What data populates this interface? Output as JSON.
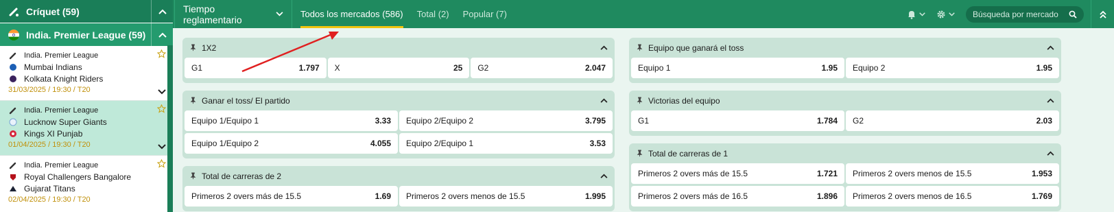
{
  "sidebar": {
    "sport": {
      "label": "Críquet (59)",
      "icon": "cricket-bat-icon"
    },
    "league": {
      "label": "India. Premier League (59)",
      "icon": "india-flag-icon"
    },
    "matches": [
      {
        "league": "India. Premier League",
        "team1": "Mumbai Indians",
        "team2": "Kolkata Knight Riders",
        "date": "31/03/2025 / 19:30 / T20",
        "selected": false
      },
      {
        "league": "India. Premier League",
        "team1": "Lucknow Super Giants",
        "team2": "Kings XI Punjab",
        "date": "01/04/2025 / 19:30 / T20",
        "selected": true
      },
      {
        "league": "India. Premier League",
        "team1": "Royal Challengers Bangalore",
        "team2": "Gujarat Titans",
        "date": "02/04/2025 / 19:30 / T20",
        "selected": false
      }
    ]
  },
  "topbar": {
    "period": "Tiempo reglamentario",
    "tabs": [
      {
        "label": "Todos los mercados",
        "count": "(586)",
        "active": true
      },
      {
        "label": "Total",
        "count": "(2)",
        "active": false
      },
      {
        "label": "Popular",
        "count": "(7)",
        "active": false
      }
    ],
    "search_placeholder": "Búsqueda por mercado"
  },
  "markets_left": [
    {
      "title": "1X2",
      "rows": [
        [
          {
            "label": "G1",
            "odd": "1.797"
          },
          {
            "label": "X",
            "odd": "25"
          },
          {
            "label": "G2",
            "odd": "2.047"
          }
        ]
      ]
    },
    {
      "title": "Ganar el toss/ El partido",
      "rows": [
        [
          {
            "label": "Equipo 1/Equipo 1",
            "odd": "3.33"
          },
          {
            "label": "Equipo 2/Equipo 2",
            "odd": "3.795"
          }
        ],
        [
          {
            "label": "Equipo 1/Equipo 2",
            "odd": "4.055"
          },
          {
            "label": "Equipo 2/Equipo 1",
            "odd": "3.53"
          }
        ]
      ]
    },
    {
      "title": "Total de carreras de 2",
      "rows": [
        [
          {
            "label": "Primeros 2 overs más de 15.5",
            "odd": "1.69"
          },
          {
            "label": "Primeros 2 overs menos de 15.5",
            "odd": "1.995"
          }
        ]
      ]
    }
  ],
  "markets_right": [
    {
      "title": "Equipo que ganará el toss",
      "rows": [
        [
          {
            "label": "Equipo 1",
            "odd": "1.95"
          },
          {
            "label": "Equipo 2",
            "odd": "1.95"
          }
        ]
      ]
    },
    {
      "title": "Victorias del equipo",
      "rows": [
        [
          {
            "label": "G1",
            "odd": "1.784"
          },
          {
            "label": "G2",
            "odd": "2.03"
          }
        ]
      ]
    },
    {
      "title": "Total de carreras de 1",
      "rows": [
        [
          {
            "label": "Primeros 2 overs más de 15.5",
            "odd": "1.721"
          },
          {
            "label": "Primeros 2 overs menos de 15.5",
            "odd": "1.953"
          }
        ],
        [
          {
            "label": "Primeros 2 overs más de 16.5",
            "odd": "1.896"
          },
          {
            "label": "Primeros 2 overs menos de 16.5",
            "odd": "1.769"
          }
        ]
      ]
    }
  ],
  "colors": {
    "dark_green": "#1a7e58",
    "header_green": "#1f8a5f",
    "market_bg": "#c9e3d7",
    "active_tab_underline": "#f1c40f",
    "date": "#c0900a",
    "annotation_arrow": "#e02020"
  }
}
